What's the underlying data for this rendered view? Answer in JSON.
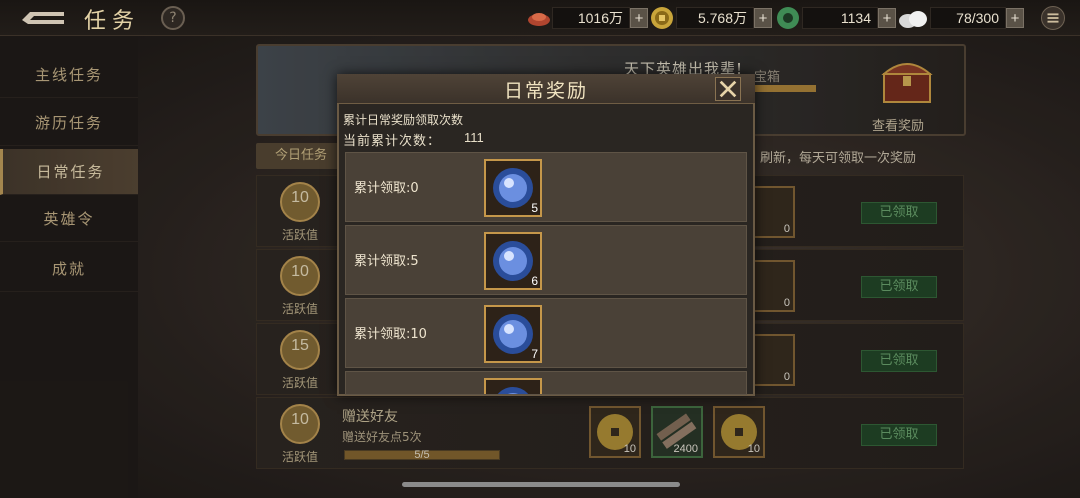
{
  "header": {
    "title": "任务",
    "help": "?",
    "resources": [
      {
        "name": "copper",
        "value": "1016万",
        "plus": "+"
      },
      {
        "name": "gold-coin",
        "value": "5.768万",
        "plus": "+"
      },
      {
        "name": "jade",
        "value": "1134",
        "plus": "+"
      },
      {
        "name": "stamina",
        "value": "78/300",
        "plus": "+"
      }
    ]
  },
  "sidebar": {
    "items": [
      {
        "label": "主线任务"
      },
      {
        "label": "游历任务"
      },
      {
        "label": "日常任务"
      },
      {
        "label": "英雄令"
      },
      {
        "label": "成就"
      }
    ]
  },
  "banner": {
    "slogan": "天下英雄出我辈!",
    "chest_label": "宝箱",
    "view_reward": "查看奖励"
  },
  "today_tab": "今日任务",
  "refresh_note": "刷新，每天可领取一次奖励",
  "tasks": [
    {
      "activity": "10",
      "activity_label": "活跃值",
      "button": "已领取",
      "counts": [
        "0"
      ]
    },
    {
      "activity": "10",
      "activity_label": "活跃值",
      "button": "已领取",
      "counts": [
        "0"
      ]
    },
    {
      "activity": "15",
      "activity_label": "活跃值",
      "button": "已领取",
      "counts": [
        "0"
      ]
    },
    {
      "activity": "10",
      "activity_label": "活跃值",
      "button": "已领取",
      "title": "赠送好友",
      "desc": "赠送好友点5次",
      "progress": "5/5",
      "counts": [
        "10",
        "2400",
        "10"
      ]
    }
  ],
  "modal": {
    "title": "日常奖励",
    "subtitle": "累计日常奖励领取次数",
    "count_label": "当前累计次数：",
    "count_value": "111",
    "rows": [
      {
        "label": "累计领取:0",
        "reward_count": "5"
      },
      {
        "label": "累计领取:5",
        "reward_count": "6"
      },
      {
        "label": "累计领取:10",
        "reward_count": "7"
      },
      {
        "label": "",
        "reward_count": ""
      }
    ]
  }
}
